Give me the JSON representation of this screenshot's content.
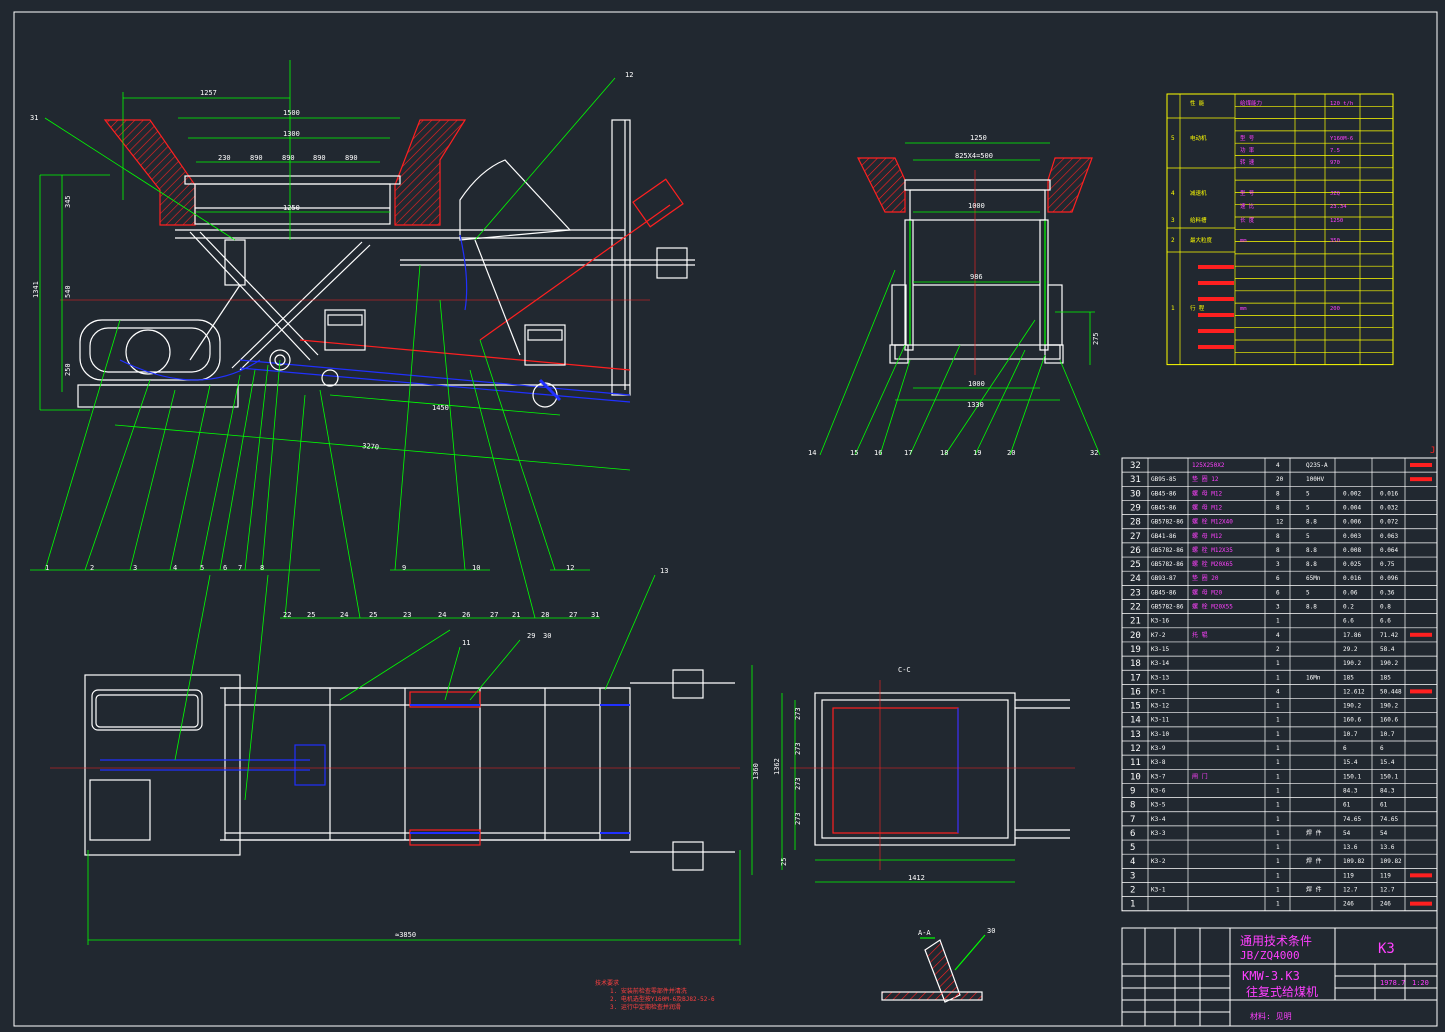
{
  "colors": {
    "background": "#212830",
    "line": "#ffffff",
    "dim": "#00ff00",
    "hatch": "#ff2020",
    "hidden": "#2030ff",
    "table_line": "#ffff00",
    "title_text": "#ff40ff"
  },
  "dims": {
    "d1257": "1257",
    "d1500": "1500",
    "d1300": "1300",
    "d1250": "1250",
    "d230": "230",
    "d890a": "890",
    "d890b": "890",
    "d890c": "890",
    "d890d": "890",
    "d345": "345",
    "d540": "540",
    "d1341": "1341",
    "d250": "250",
    "d1450": "1450",
    "d3270": "3270",
    "s1250": "1250",
    "s825": "825X4=500",
    "s1000": "1000",
    "s986": "986",
    "s1000b": "1000",
    "s1330": "1330",
    "s275": "275",
    "b1360": "1360",
    "b1362": "1362",
    "b3850": "≈3850",
    "c273a": "273",
    "c273b": "273",
    "c273c": "273",
    "c273d": "273",
    "c25": "25",
    "c1412": "1412",
    "cc": "C-C",
    "aa": "A-A"
  },
  "balloons_top": [
    "1",
    "2",
    "3",
    "4",
    "5",
    "6",
    "7",
    "8",
    "9",
    "10",
    "12"
  ],
  "balloons_mid": [
    "22",
    "25",
    "24",
    "25",
    "23",
    "24",
    "26",
    "27",
    "21",
    "28",
    "27",
    "31"
  ],
  "balloons_side": [
    "14",
    "15",
    "16",
    "17",
    "18",
    "19",
    "20",
    "32"
  ],
  "balloon_labels": {
    "b31": "31",
    "b12": "12",
    "b11": "11",
    "b29": "29",
    "b30": "30",
    "b13": "13",
    "b30b": "30"
  },
  "notes": [
    "技术要求",
    "1. 安装前检查零部件并清洗",
    "2. 电机选型按Y160M-6及BJ82-52-6",
    "3. 运行中定期检查并润滑"
  ],
  "title_block": {
    "standard1": "通用技术条件",
    "standard2": "JB/ZQ4000",
    "code": "K3",
    "name1": "KMW-3.K3",
    "name2": "往复式给煤机",
    "material": "材料: 见明",
    "scale": "1:20",
    "sheet": "1978.7"
  },
  "tech_table": {
    "rows": [
      {
        "no": "",
        "name": "性 能",
        "a": "给煤能力",
        "b": "",
        "v": "120 t/h"
      },
      {
        "no": "5",
        "name": "电动机",
        "a": "型 号",
        "b": "",
        "v": "Y160M-6"
      },
      {
        "no": "",
        "name": "",
        "a": "功 率",
        "b": "",
        "v": "7.5"
      },
      {
        "no": "",
        "name": "",
        "a": "转 速",
        "b": "",
        "v": "970"
      },
      {
        "no": "4",
        "name": "减速机",
        "a": "型 号",
        "b": "",
        "v": "JZQ"
      },
      {
        "no": "",
        "name": "",
        "a": "速 比",
        "b": "",
        "v": "23.34"
      },
      {
        "no": "3",
        "name": "给料槽",
        "a": "长 度",
        "b": "",
        "v": "1250"
      },
      {
        "no": "2",
        "name": "最大粒度",
        "a": "mm",
        "b": "",
        "v": "350"
      },
      {
        "no": "1",
        "name": "行 程",
        "a": "mm",
        "b": "",
        "v": "200"
      }
    ]
  },
  "parts_table": {
    "flag": "J",
    "rows": [
      {
        "no": "32",
        "code": "",
        "name": "125X250X2",
        "qty": "4",
        "mat": "Q235-A",
        "w1": "",
        "w2": ""
      },
      {
        "no": "31",
        "code": "GB95-85",
        "name": "垫 圈 12",
        "qty": "20",
        "mat": "100HV",
        "w1": "",
        "w2": ""
      },
      {
        "no": "30",
        "code": "GB45-86",
        "name": "螺 母 M12",
        "qty": "8",
        "mat": "5",
        "w1": "0.002",
        "w2": "0.016"
      },
      {
        "no": "29",
        "code": "GB45-86",
        "name": "螺 母 M12",
        "qty": "8",
        "mat": "5",
        "w1": "0.004",
        "w2": "0.032"
      },
      {
        "no": "28",
        "code": "GB5782-86",
        "name": "螺 栓 M12X40",
        "qty": "12",
        "mat": "8.8",
        "w1": "0.006",
        "w2": "0.072"
      },
      {
        "no": "27",
        "code": "GB41-86",
        "name": "螺 母 M12",
        "qty": "8",
        "mat": "5",
        "w1": "0.003",
        "w2": "0.063"
      },
      {
        "no": "26",
        "code": "GB5782-86",
        "name": "螺 栓 M12X35",
        "qty": "8",
        "mat": "8.8",
        "w1": "0.008",
        "w2": "0.064"
      },
      {
        "no": "25",
        "code": "GB5782-86",
        "name": "螺 栓 M20X65",
        "qty": "3",
        "mat": "8.8",
        "w1": "0.025",
        "w2": "0.75"
      },
      {
        "no": "24",
        "code": "GB93-87",
        "name": "垫 圈 20",
        "qty": "6",
        "mat": "65Mn",
        "w1": "0.016",
        "w2": "0.096"
      },
      {
        "no": "23",
        "code": "GB45-86",
        "name": "螺 母 M20",
        "qty": "6",
        "mat": "5",
        "w1": "0.06",
        "w2": "0.36"
      },
      {
        "no": "22",
        "code": "GB5782-86",
        "name": "螺 栓 M20X55",
        "qty": "3",
        "mat": "8.8",
        "w1": "0.2",
        "w2": "0.8"
      },
      {
        "no": "21",
        "code": "K3-16",
        "name": "",
        "qty": "1",
        "mat": "",
        "w1": "6.6",
        "w2": "6.6"
      },
      {
        "no": "20",
        "code": "K7-2",
        "name": "托 辊",
        "qty": "4",
        "mat": "",
        "w1": "17.86",
        "w2": "71.42"
      },
      {
        "no": "19",
        "code": "K3-15",
        "name": "",
        "qty": "2",
        "mat": "",
        "w1": "29.2",
        "w2": "58.4"
      },
      {
        "no": "18",
        "code": "K3-14",
        "name": "",
        "qty": "1",
        "mat": "",
        "w1": "190.2",
        "w2": "190.2"
      },
      {
        "no": "17",
        "code": "K3-13",
        "name": "",
        "qty": "1",
        "mat": "16Mn",
        "w1": "185",
        "w2": "185"
      },
      {
        "no": "16",
        "code": "K7-1",
        "name": "",
        "qty": "4",
        "mat": "",
        "w1": "12.612",
        "w2": "50.448"
      },
      {
        "no": "15",
        "code": "K3-12",
        "name": "",
        "qty": "1",
        "mat": "",
        "w1": "190.2",
        "w2": "190.2"
      },
      {
        "no": "14",
        "code": "K3-11",
        "name": "",
        "qty": "1",
        "mat": "",
        "w1": "160.6",
        "w2": "160.6"
      },
      {
        "no": "13",
        "code": "K3-10",
        "name": "",
        "qty": "1",
        "mat": "",
        "w1": "10.7",
        "w2": "10.7"
      },
      {
        "no": "12",
        "code": "K3-9",
        "name": "",
        "qty": "1",
        "mat": "",
        "w1": "6",
        "w2": "6"
      },
      {
        "no": "11",
        "code": "K3-8",
        "name": "",
        "qty": "1",
        "mat": "",
        "w1": "15.4",
        "w2": "15.4"
      },
      {
        "no": "10",
        "code": "K3-7",
        "name": "闸 门",
        "qty": "1",
        "mat": "",
        "w1": "150.1",
        "w2": "150.1"
      },
      {
        "no": "9",
        "code": "K3-6",
        "name": "",
        "qty": "1",
        "mat": "",
        "w1": "84.3",
        "w2": "84.3"
      },
      {
        "no": "8",
        "code": "K3-5",
        "name": "",
        "qty": "1",
        "mat": "",
        "w1": "61",
        "w2": "61"
      },
      {
        "no": "7",
        "code": "K3-4",
        "name": "",
        "qty": "1",
        "mat": "",
        "w1": "74.65",
        "w2": "74.65"
      },
      {
        "no": "6",
        "code": "K3-3",
        "name": "",
        "qty": "1",
        "mat": "焊 件",
        "w1": "54",
        "w2": "54"
      },
      {
        "no": "5",
        "code": "",
        "name": "",
        "qty": "1",
        "mat": "",
        "w1": "13.6",
        "w2": "13.6"
      },
      {
        "no": "4",
        "code": "K3-2",
        "name": "",
        "qty": "1",
        "mat": "焊 件",
        "w1": "109.82",
        "w2": "109.82"
      },
      {
        "no": "3",
        "code": "",
        "name": "",
        "qty": "1",
        "mat": "",
        "w1": "119",
        "w2": "119"
      },
      {
        "no": "2",
        "code": "K3-1",
        "name": "",
        "qty": "1",
        "mat": "焊 件",
        "w1": "12.7",
        "w2": "12.7"
      },
      {
        "no": "1",
        "code": "",
        "name": "",
        "qty": "1",
        "mat": "",
        "w1": "246",
        "w2": "246"
      }
    ]
  }
}
